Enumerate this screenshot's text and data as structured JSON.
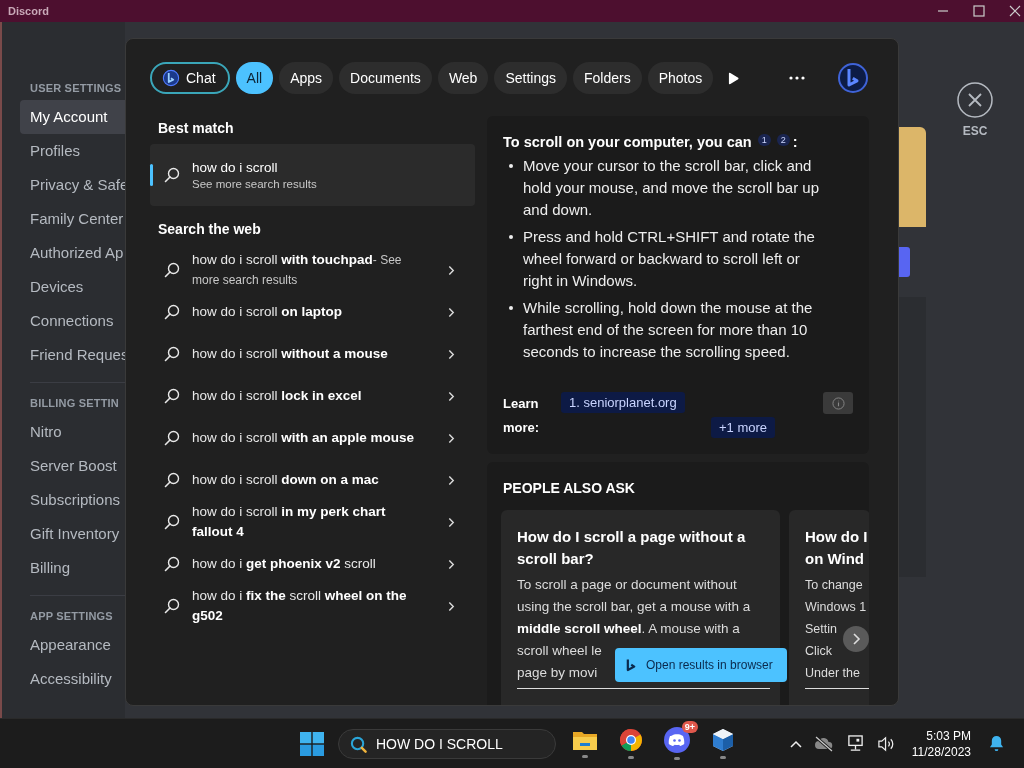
{
  "window": {
    "title": "Discord"
  },
  "sidebar": {
    "sections": [
      {
        "heading": "USER SETTINGS",
        "items": [
          {
            "label": "My Account",
            "selected": true
          },
          {
            "label": "Profiles",
            "selected": false
          },
          {
            "label": "Privacy & Safe",
            "selected": false
          },
          {
            "label": "Family Center",
            "selected": false
          },
          {
            "label": "Authorized Ap",
            "selected": false
          },
          {
            "label": "Devices",
            "selected": false
          },
          {
            "label": "Connections",
            "selected": false
          },
          {
            "label": "Friend Reques",
            "selected": false
          }
        ]
      },
      {
        "heading": "BILLING SETTIN",
        "items": [
          {
            "label": "Nitro",
            "selected": false
          },
          {
            "label": "Server Boost",
            "selected": false
          },
          {
            "label": "Subscriptions",
            "selected": false
          },
          {
            "label": "Gift Inventory",
            "selected": false
          },
          {
            "label": "Billing",
            "selected": false
          }
        ]
      },
      {
        "heading": "APP SETTINGS",
        "items": [
          {
            "label": "Appearance",
            "selected": false
          },
          {
            "label": "Accessibility",
            "selected": false
          }
        ]
      }
    ]
  },
  "esc_label": "ESC",
  "search_flyout": {
    "filters": [
      {
        "label": "Chat",
        "kind": "chat",
        "selected": false
      },
      {
        "label": "All",
        "kind": "tab",
        "selected": true
      },
      {
        "label": "Apps",
        "kind": "tab",
        "selected": false
      },
      {
        "label": "Documents",
        "kind": "tab",
        "selected": false
      },
      {
        "label": "Web",
        "kind": "tab",
        "selected": false
      },
      {
        "label": "Settings",
        "kind": "tab",
        "selected": false
      },
      {
        "label": "Folders",
        "kind": "tab",
        "selected": false
      },
      {
        "label": "Photos",
        "kind": "tab",
        "selected": false
      }
    ],
    "best_match": {
      "heading": "Best match",
      "title": "how do i scroll",
      "subtitle": "See more search results",
      "selected": true
    },
    "web": {
      "heading": "Search the web",
      "items": [
        {
          "text": "how do i scroll **with touchpad**",
          "note": "- See more search results"
        },
        {
          "text": "how do i scroll **on laptop**"
        },
        {
          "text": "how do i scroll **without a mouse**"
        },
        {
          "text": "how do i scroll **lock in excel**"
        },
        {
          "text": "how do i scroll **with an apple mouse**"
        },
        {
          "text": "how do i scroll **down on a mac**"
        },
        {
          "text": "how do i scroll **in my perk chart fallout 4**"
        },
        {
          "text": "how do i **get phoenix v2** scroll"
        },
        {
          "text": "how do i **fix the** scroll **wheel on the g502**"
        }
      ]
    },
    "answer": {
      "title": "To scroll on your computer, you can",
      "citations": [
        "1",
        "2"
      ],
      "title_end": ":",
      "bullets": [
        "Move your cursor to the scroll bar, click and hold your mouse, and move the scroll bar up and down.",
        "Press and hold CTRL+SHIFT and rotate the wheel forward or backward to scroll left or right in Windows.",
        "While scrolling, hold down the mouse at the farthest end of the screen for more than 10 seconds to increase the scrolling speed."
      ],
      "learn_more_label": "Learn more:",
      "links": [
        "1. seniorplanet.org",
        "+1 more"
      ]
    },
    "people_also_ask": {
      "heading": "PEOPLE ALSO ASK",
      "cards": [
        {
          "title": "How do I scroll a page without a scroll bar?",
          "body": "To scroll a page or document without using the scroll bar, get a mouse with a **middle scroll wheel**. A mouse with a",
          "cut_lines": [
            "scroll wheel le",
            "page by movi"
          ]
        },
        {
          "title_lines": [
            "How do I",
            "on Wind"
          ],
          "cut_lines": [
            "To change",
            "Windows 1",
            "Settin",
            "Click",
            "Under the"
          ]
        }
      ]
    },
    "open_browser_button": "Open results in browser"
  },
  "taskbar": {
    "search_value": "HOW DO I SCROLL",
    "apps": [
      {
        "kind": "files",
        "running": true
      },
      {
        "kind": "chrome",
        "running": true
      },
      {
        "kind": "discord",
        "running": true,
        "badge": "9+"
      },
      {
        "kind": "virtualbox",
        "running": true
      }
    ],
    "time": "5:03 PM",
    "date": "11/28/2023"
  }
}
